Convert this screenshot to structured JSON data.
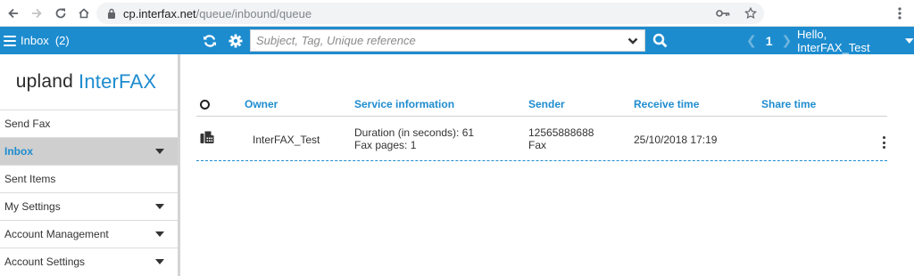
{
  "browser": {
    "url_host": "cp.interfax.net",
    "url_path": "/queue/inbound/queue"
  },
  "header": {
    "inbox_label": "Inbox",
    "inbox_count": "(2)",
    "search_placeholder": "Subject, Tag, Unique reference",
    "page_number": "1",
    "greeting": "Hello, InterFAX_Test"
  },
  "logo": {
    "part1": "upland",
    "part2": "InterFAX"
  },
  "sidebar": {
    "items": [
      {
        "label": "Send Fax"
      },
      {
        "label": "Inbox"
      },
      {
        "label": "Sent Items"
      },
      {
        "label": "My Settings"
      },
      {
        "label": "Account Management"
      },
      {
        "label": "Account Settings"
      }
    ]
  },
  "table": {
    "columns": [
      "Owner",
      "Service information",
      "Sender",
      "Receive time",
      "Share time"
    ],
    "rows": [
      {
        "owner": "InterFAX_Test",
        "duration": "Duration (in seconds): 61",
        "pages": "Fax pages: 1",
        "sender_number": "12565888688",
        "sender_type": "Fax",
        "receive_time": "25/10/2018 17:19",
        "share_time": ""
      }
    ]
  },
  "colors": {
    "accent": "#1d8ccf",
    "active_item_bg": "#cfcfcf"
  },
  "icons": {
    "back": "arrow-left-icon",
    "forward": "arrow-right-icon",
    "reload": "reload-icon",
    "home": "home-icon",
    "lock": "lock-icon",
    "key": "key-icon",
    "star": "star-icon",
    "refresh": "refresh-icon",
    "settings": "gear-icon",
    "search": "search-icon",
    "fax": "fax-icon",
    "more": "kebab-icon"
  }
}
